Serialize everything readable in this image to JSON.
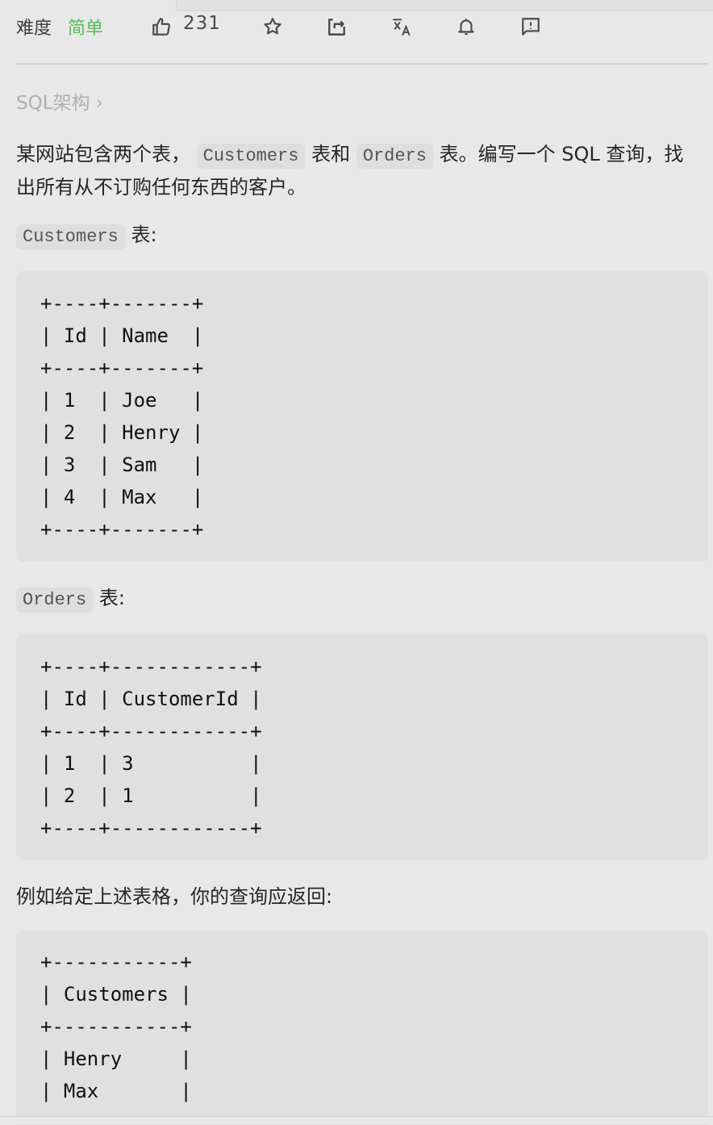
{
  "toolbar": {
    "difficulty_label": "难度",
    "difficulty_value": "简单",
    "difficulty_color": "#5cb85c",
    "like_count": "231",
    "icons": [
      "thumbs-up-icon",
      "star-icon",
      "share-icon",
      "translate-icon",
      "bell-icon",
      "feedback-icon"
    ]
  },
  "breadcrumb": {
    "label": "SQL架构 ›"
  },
  "description": {
    "part1": "某网站包含两个表，",
    "code1": "Customers",
    "part2": "表和",
    "code2": "Orders",
    "part3": "表。编写一个 SQL 查询，找出所有从不订购任何东西的客户。"
  },
  "customers_caption": {
    "code": "Customers",
    "text": "表:"
  },
  "customers_table": {
    "lines": [
      "+----+-------+",
      "| Id | Name  |",
      "+----+-------+",
      "| 1  | Joe   |",
      "| 2  | Henry |",
      "| 3  | Sam   |",
      "| 4  | Max   |",
      "+----+-------+"
    ]
  },
  "orders_caption": {
    "code": "Orders",
    "text": "表:"
  },
  "orders_table": {
    "lines": [
      "+----+------------+",
      "| Id | CustomerId |",
      "+----+------------+",
      "| 1  | 3          |",
      "| 2  | 1          |",
      "+----+------------+"
    ]
  },
  "example_text": "例如给定上述表格，你的查询应返回:",
  "result_table": {
    "lines": [
      "+-----------+",
      "| Customers |",
      "+-----------+",
      "| Henry     |",
      "| Max       |"
    ]
  }
}
